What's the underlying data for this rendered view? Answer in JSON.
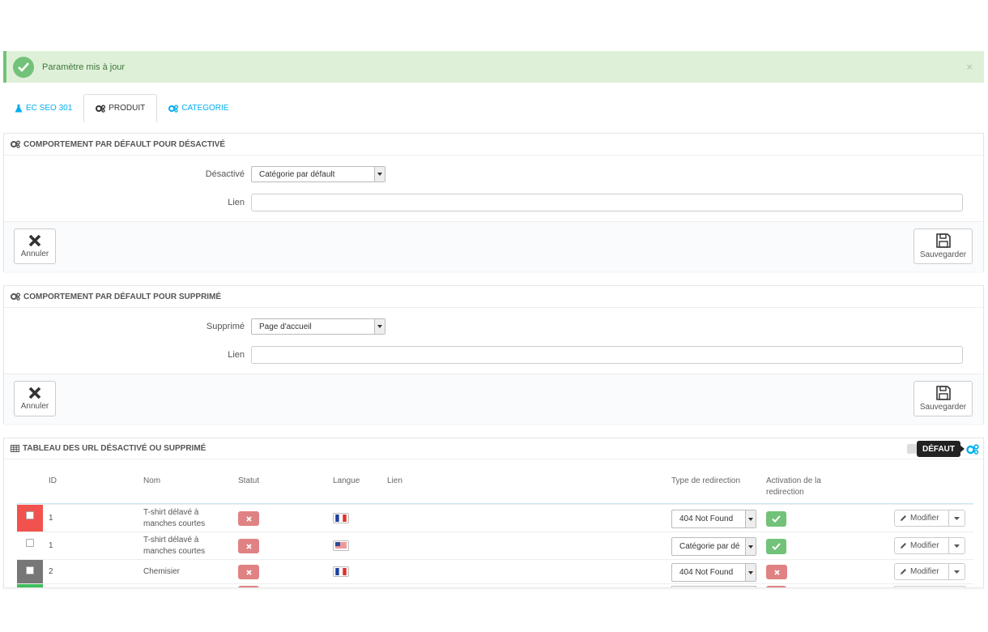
{
  "alert": {
    "message": "Paramètre mis à jour",
    "close": "×"
  },
  "tabs": [
    {
      "label": "EC SEO 301",
      "icon": "flask-icon"
    },
    {
      "label": "PRODUIT",
      "icon": "cogs-icon"
    },
    {
      "label": "CATEGORIE",
      "icon": "cogs-icon"
    }
  ],
  "panel_disabled": {
    "title": "COMPORTEMENT PAR DÉFAULT POUR DÉSACTIVÉ",
    "select_label": "Désactivé",
    "select_value": "Catégorie par défault",
    "link_label": "Lien",
    "link_value": "",
    "cancel_label": "Annuler",
    "save_label": "Sauvegarder"
  },
  "panel_deleted": {
    "title": "COMPORTEMENT PAR DÉFAULT POUR SUPPRIMÉ",
    "select_label": "Supprimé",
    "select_value": "Page d'accueil",
    "link_label": "Lien",
    "link_value": "",
    "cancel_label": "Annuler",
    "save_label": "Sauvegarder"
  },
  "table": {
    "title": "TABLEAU DES URL DÉSACTIVÉ OU SUPPRIMÉ",
    "tooltip": "DÉFAUT",
    "columns": {
      "id": "ID",
      "name": "Nom",
      "status": "Statut",
      "lang": "Langue",
      "link": "Lien",
      "redirect_type": "Type de redirection",
      "activation": "Activation de la redirection"
    },
    "rows": [
      {
        "id": "1",
        "name": "T-shirt délavé à manches courtes",
        "status": "off",
        "lang_flag": "fr-flag-icon",
        "redirect_type": "404 Not Found",
        "activation": "on",
        "marker_color": "#f1524d",
        "action": "Modifier"
      },
      {
        "id": "1",
        "name": "T-shirt délavé à manches courtes",
        "status": "off",
        "lang_flag": "us-flag-icon",
        "redirect_type": "Catégorie par dé",
        "activation": "on",
        "marker_color": "",
        "action": "Modifier"
      },
      {
        "id": "2",
        "name": "Chemisier",
        "status": "off",
        "lang_flag": "fr-flag-icon",
        "redirect_type": "404 Not Found",
        "activation": "off",
        "marker_color": "#777777",
        "action": "Modifier"
      }
    ]
  },
  "colors": {
    "accent": "#00aff0",
    "success": "#72c279",
    "danger": "#e08283"
  }
}
